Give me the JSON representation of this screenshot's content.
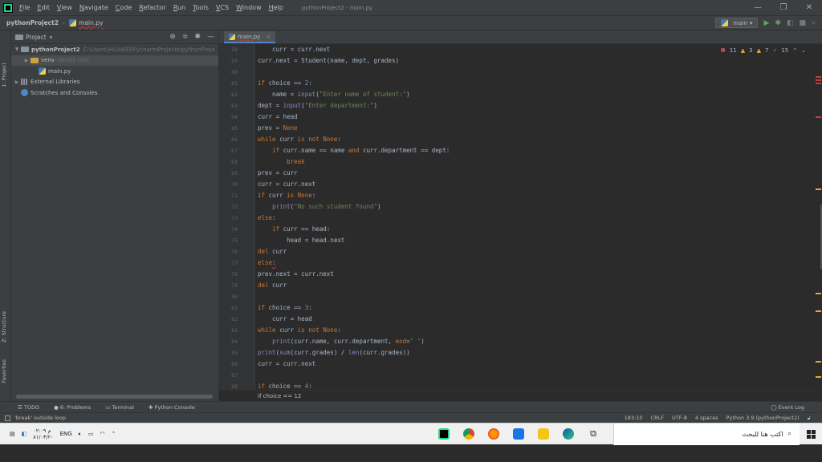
{
  "menubar": {
    "items": [
      "File",
      "Edit",
      "View",
      "Navigate",
      "Code",
      "Refactor",
      "Run",
      "Tools",
      "VCS",
      "Window",
      "Help"
    ],
    "window_title": "pythonProject2 - main.py",
    "minimize": "—",
    "restore": "❐",
    "close": "✕"
  },
  "navbar": {
    "project": "pythonProject2",
    "file": "main.py",
    "branch": "main",
    "search": "⌕"
  },
  "leftstrip": {
    "project_tab": "1: Project",
    "structure_tab": "Z: Structure",
    "favorites_tab": "Favorites"
  },
  "project_panel": {
    "title": "Project",
    "root_name": "pythonProject2",
    "root_path": "C:\\Users\\HUAWEI\\PycharmProjects\\pythonProje",
    "venv_name": "venv",
    "venv_label": "library root",
    "file": "main.py",
    "external_libraries": "External Libraries",
    "scratches": "Scratches and Consoles"
  },
  "editor": {
    "tab_label": "main.py",
    "inspection": {
      "errors": "11",
      "warnings": "3",
      "weak_warnings": "7",
      "typos": "15"
    },
    "breadcrumb": "if choice == 12",
    "line_numbers": [
      "58",
      "59",
      "60",
      "61",
      "62",
      "63",
      "64",
      "65",
      "66",
      "67",
      "68",
      "69",
      "70",
      "71",
      "72",
      "73",
      "74",
      "75",
      "76",
      "77",
      "78",
      "79",
      "80",
      "81",
      "82",
      "83",
      "84",
      "85",
      "86",
      "87",
      "88",
      "89"
    ]
  },
  "bottom_tools": {
    "todo": "TODO",
    "problems": "6: Problems",
    "terminal": "Terminal",
    "python_console": "Python Console",
    "event_log": "Event Log"
  },
  "status": {
    "message": "'break' outside loop",
    "position": "183:10",
    "line_sep": "CRLF",
    "encoding": "UTF-8",
    "indent": "4 spaces",
    "interpreter": "Python 3.9 (pythonProject2)"
  },
  "taskbar": {
    "time": "م ٠٢:٠٩",
    "date": "٨١/٠٣/٢٠",
    "lang": "ENG",
    "search_placeholder": "اكتب هنا للبحث"
  },
  "colors": {
    "keyword": "#cc7832",
    "string": "#6a8759",
    "number": "#6897bb",
    "builtin": "#8888c6",
    "error": "#bc3f3c",
    "warning": "#e0a83e"
  }
}
